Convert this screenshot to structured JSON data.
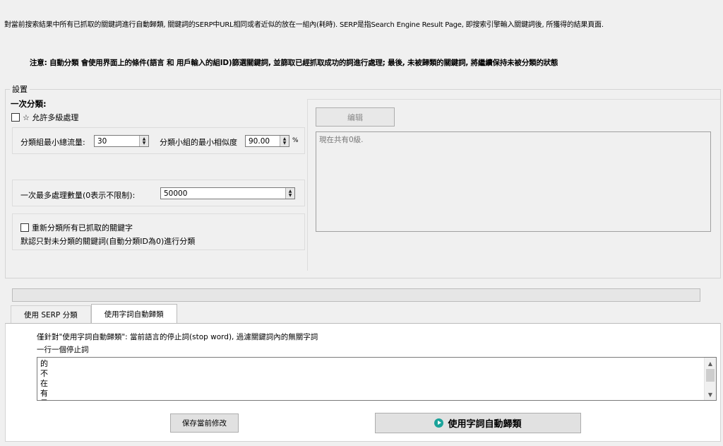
{
  "intro_text": "對當前搜索結果中所有已抓取的關鍵詞進行自動歸類, 關鍵詞的SERP中URL相同或者近似的放在一組內(耗時).  SERP是指Search Engine Result Page, 即搜索引擎輸入關鍵詞後, 所獲得的結果頁面.",
  "notice_text": "注意: 自動分類 會使用界面上的條件(語言 和 用戶輸入的組ID)篩選關鍵詞, 並篩取已經抓取成功的詞進行處理; 最後, 未被歸類的關鍵詞, 將繼續保持未被分類的狀態",
  "settings": {
    "legend": "設置",
    "first_class_title": "一次分類:",
    "allow_multi_label": "☆ 允許多級處理",
    "min_traffic_label": "分類組最小總流量:",
    "min_traffic_value": "30",
    "min_similarity_label": "分類小組的最小相似度",
    "min_similarity_value": "90.00",
    "percent_label": "%",
    "max_process_label": "一次最多處理數量(0表示不限制):",
    "max_process_value": "50000",
    "reclassify_label": "重新分類所有已抓取的關鍵字",
    "default_note": "默認只對未分類的關鍵詞(自動分類ID為0)進行分類",
    "edit_button": "编辑",
    "levels_text": "現在共有0級."
  },
  "tabs": [
    {
      "label": "使用 SERP 分類",
      "active": false
    },
    {
      "label": "使用字詞自動歸類",
      "active": true
    }
  ],
  "tab_content": {
    "tip1": "僅針對\"使用字詞自動歸類\": 當前語言的停止詞(stop word), 過濾關鍵詞內的無關字詞",
    "tip2": "一行一個停止詞",
    "stopwords": [
      "的",
      "不",
      "在",
      "有",
      "是"
    ]
  },
  "buttons": {
    "save_label": "保存當前修改",
    "auto_label": "使用字詞自動歸類"
  },
  "colors": {
    "accent_icon": "#1aa39a",
    "background": "#f0f0f0"
  }
}
